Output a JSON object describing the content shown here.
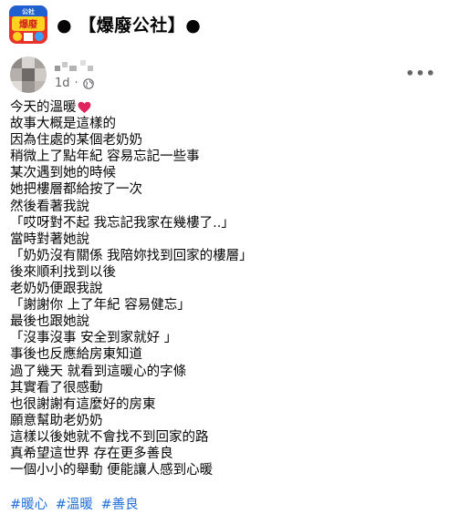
{
  "group": {
    "name": "● 【爆廢公社】●",
    "avatar_icon": "group-logo-icon",
    "avatar_text": "爆廢公社"
  },
  "post": {
    "time": "1d",
    "separator": "·",
    "privacy_icon": "globe-icon",
    "more_icon": "more-horizontal-icon",
    "heart_color": "#e0245e",
    "lines": [
      "今天的溫暖",
      "故事大概是這樣的",
      "因為住處的某個老奶奶",
      "稍微上了點年紀 容易忘記一些事",
      "某次遇到她的時候",
      "她把樓層都給按了一次",
      "然後看著我說",
      "「哎呀對不起 我忘記我家在幾樓了..」",
      "當時對著她說",
      "「奶奶沒有關係 我陪妳找到回家的樓層」",
      "後來順利找到以後",
      "老奶奶便跟我說",
      "「謝謝你 上了年紀 容易健忘」",
      "最後也跟她說",
      "「沒事沒事 安全到家就好 」",
      "事後也反應給房東知道",
      "過了幾天 就看到這暖心的字條",
      "其實看了很感動",
      "也很謝謝有這麼好的房東",
      "願意幫助老奶奶",
      "這樣以後她就不會找不到回家的路",
      "真希望這世界 存在更多善良",
      "一個小小的舉動 便能讓人感到心暖"
    ],
    "hashtags": [
      "#暖心",
      "#溫暖",
      "#善良"
    ],
    "link_color": "#216fdb"
  }
}
